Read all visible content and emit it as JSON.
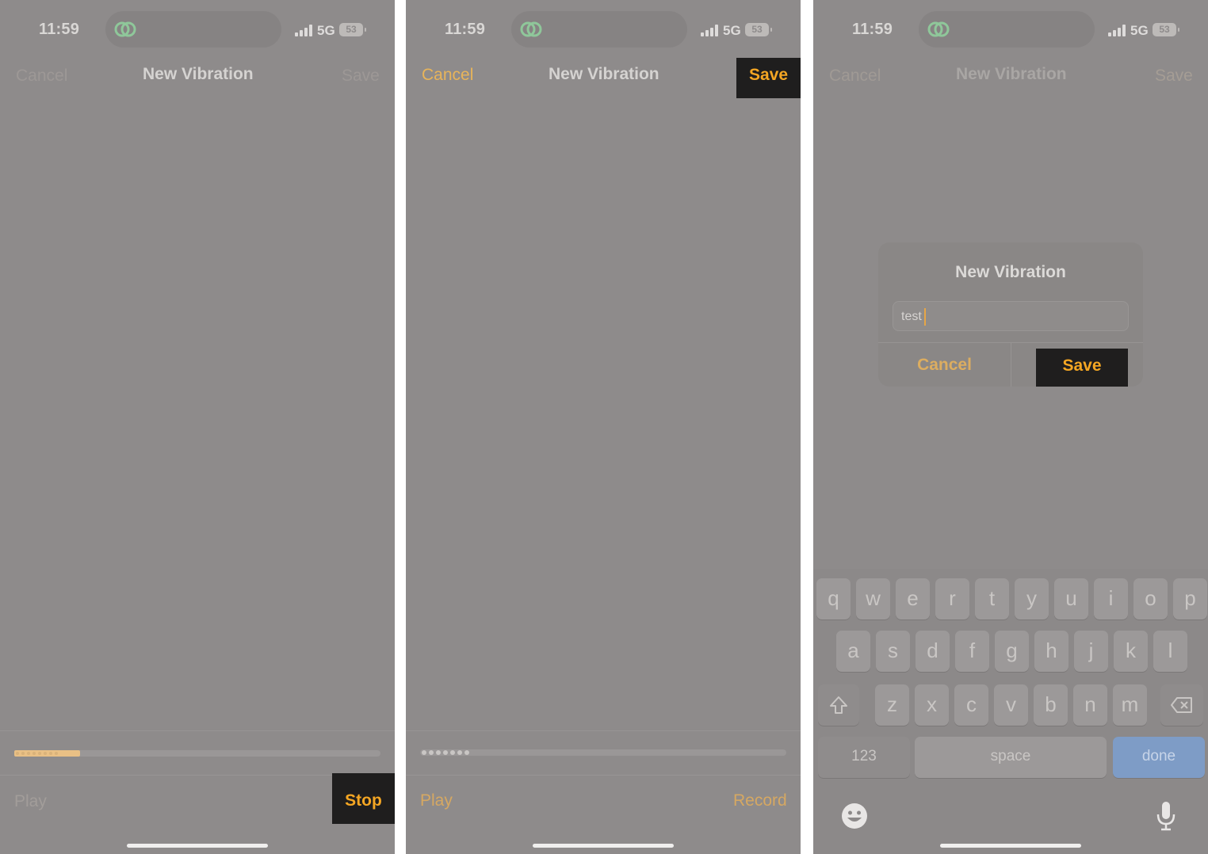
{
  "status": {
    "time": "11:59",
    "network": "5G",
    "battery": "53"
  },
  "panel1": {
    "title": "New Vibration",
    "cancel": "Cancel",
    "save": "Save",
    "play": "Play",
    "stop": "Stop",
    "progress": 0.18
  },
  "panel2": {
    "title": "New Vibration",
    "cancel": "Cancel",
    "save": "Save",
    "play": "Play",
    "record": "Record"
  },
  "panel3": {
    "title": "New Vibration",
    "cancel": "Cancel",
    "save": "Save",
    "dialog": {
      "title": "New Vibration",
      "input_value": "test",
      "cancel": "Cancel",
      "save": "Save"
    },
    "keyboard": {
      "row1": [
        "q",
        "w",
        "e",
        "r",
        "t",
        "y",
        "u",
        "i",
        "o",
        "p"
      ],
      "row2": [
        "a",
        "s",
        "d",
        "f",
        "g",
        "h",
        "j",
        "k",
        "l"
      ],
      "row3": [
        "z",
        "x",
        "c",
        "v",
        "b",
        "n",
        "m"
      ],
      "numbers": "123",
      "space": "space",
      "done": "done"
    }
  },
  "colors": {
    "accent": "#f4a623",
    "background": "#8e8b8b",
    "highlight_box": "#1f1e1e"
  },
  "icons": [
    "link-icon",
    "signal-icon",
    "battery-icon",
    "shift-icon",
    "delete-icon",
    "emoji-icon",
    "microphone-icon"
  ]
}
